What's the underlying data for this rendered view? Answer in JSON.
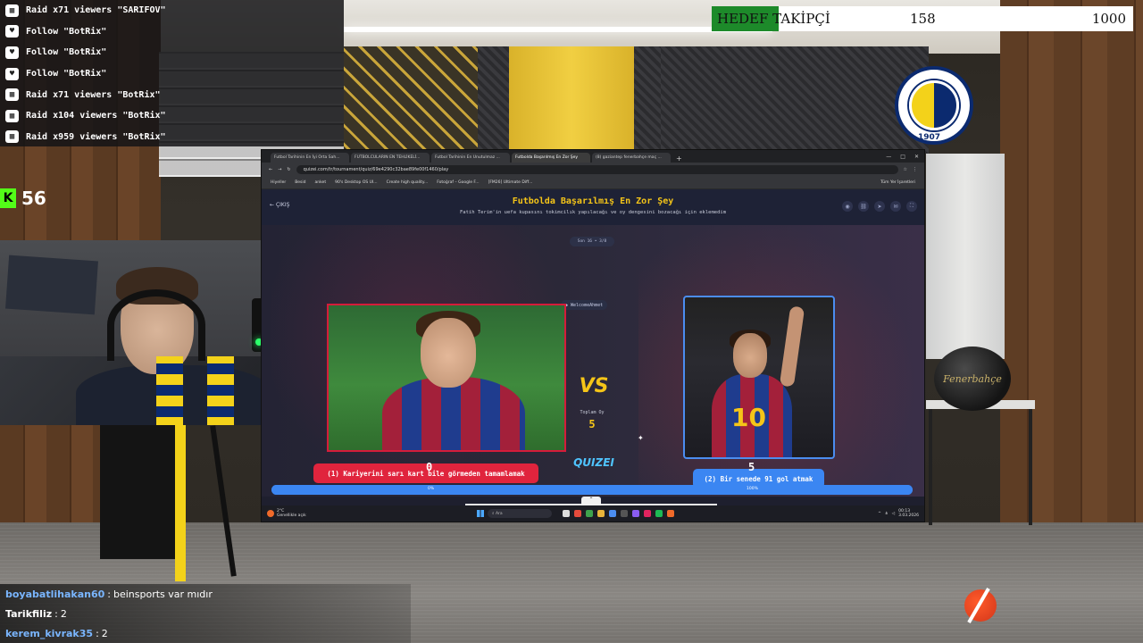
{
  "goal": {
    "label": "HEDEF TAKİPÇİ",
    "current": "158",
    "target": "1000",
    "progress_fraction": 0.158
  },
  "alerts": [
    {
      "icon": "raid-icon",
      "text": "Raid x71 viewers \"SARIFOV\""
    },
    {
      "icon": "heart-icon",
      "text": "Follow \"BotRix\""
    },
    {
      "icon": "heart-icon",
      "text": "Follow \"BotRix\""
    },
    {
      "icon": "heart-icon",
      "text": "Follow \"BotRix\""
    },
    {
      "icon": "raid-icon",
      "text": "Raid x71 viewers \"BotRix\""
    },
    {
      "icon": "raid-icon",
      "text": "Raid x104 viewers \"BotRix\""
    },
    {
      "icon": "raid-icon",
      "text": "Raid x959 viewers \"BotRix\""
    }
  ],
  "viewer_count": "56",
  "club_logo": {
    "year": "1907",
    "colors": [
      "#f3d21a",
      "#0b2a6f"
    ]
  },
  "ball_text": "Fenerbahçe",
  "browser": {
    "tabs": [
      {
        "label": "Futbol Tarihinin En İyi Orta Sah...",
        "active": false
      },
      {
        "label": "FUTBOLCULARIN EN TEHLİKELİ...",
        "active": false
      },
      {
        "label": "Futbol Tarihinin En Unutulmaz ...",
        "active": false
      },
      {
        "label": "Futbolda Başarılmış En Zor Şey",
        "active": true
      },
      {
        "label": "(8) gaziantep fenerbahçe maç ...",
        "active": false
      }
    ],
    "url": "quizei.com/tr/tournament/quiz/69e4290c32bae89fe00f1460/play",
    "bookmarks": [
      "Hiyeller",
      "Besid",
      "anket",
      "90's Desktop OS UI...",
      "Create high quality...",
      "Fotoğraf – Google F...",
      "[FM26] Ultimate Diff..."
    ],
    "bookmarks_right": "Tüm Yer İşaretleri"
  },
  "quiz": {
    "quit_label": "ÇIKIŞ",
    "title": "Futbolda Başarılmış En Zor Şey",
    "subtitle": "Fatih Terim'in uefa kupasını tokimcilık yapılacağı ve oy dengesini bozacağı için eklemedim",
    "round": "Son 16 • 3/8",
    "welcome": "WelcomeAhmet",
    "vs": "VS",
    "total_label": "Toplam Oy",
    "total_value": "5",
    "left_choice": "(1) Kariyerini sarı kart bile görmeden tamamlamak",
    "right_choice": "(2) Bir senede 91 gol atmak",
    "made_with": "made with",
    "brand": "QUIZEI",
    "left_score": "0",
    "right_score": "5",
    "left_percent": "0%",
    "right_percent": "100%",
    "right_number": "10",
    "right_fraction": 1.0
  },
  "taskbar": {
    "weather_temp": "2°C",
    "weather_desc": "Genellikle açık",
    "search": "Ara",
    "time": "00:13",
    "date": "3.03.2026"
  },
  "chat": [
    {
      "user": "boyabatlihakan60",
      "msg": "beinsports var mıdır",
      "sep": ":",
      "user_color": "#7ab6ff"
    },
    {
      "user": "Tarikfiliz",
      "msg": "2",
      "sep": ":",
      "user_color": "#ffffff"
    },
    {
      "user": "kerem_kivrak35",
      "msg": "2",
      "sep": ":",
      "user_color": "#7ab6ff"
    }
  ]
}
